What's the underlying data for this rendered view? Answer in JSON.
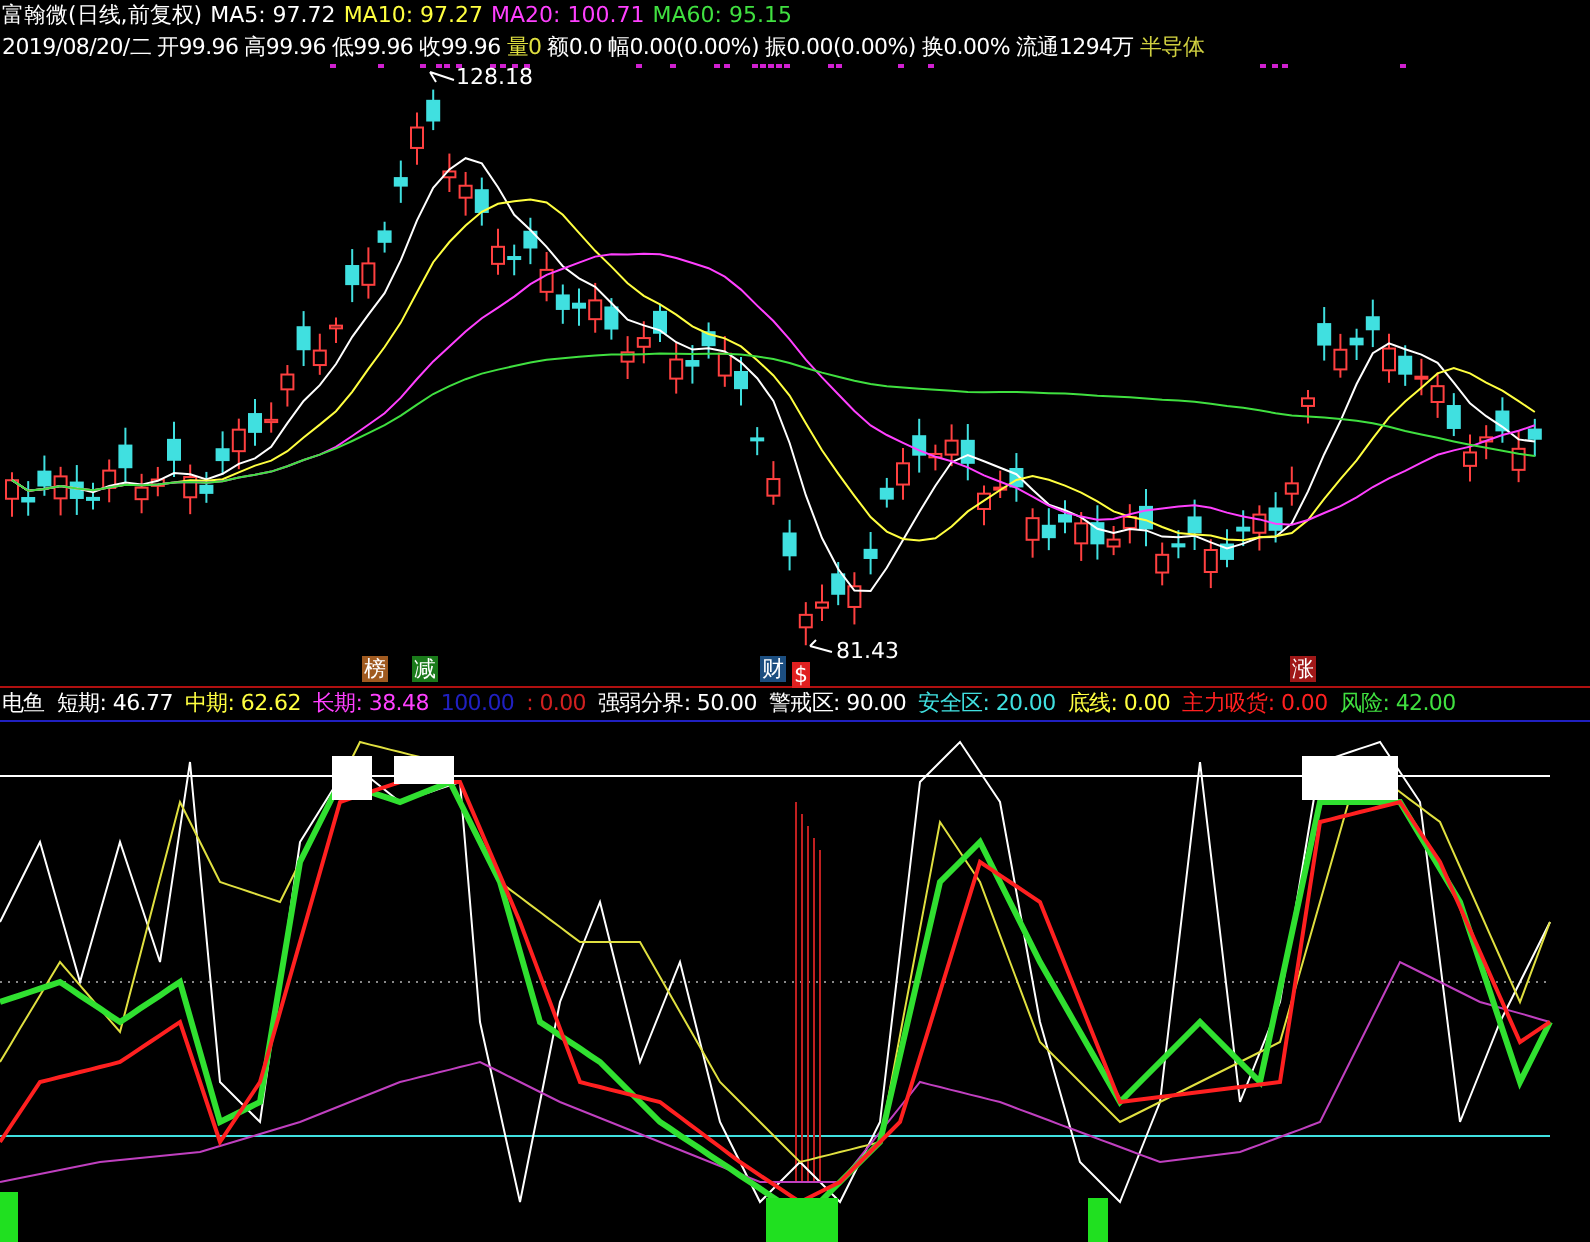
{
  "header": {
    "title": "富翰微(日线,前复权)",
    "ma": [
      "MA5: 97.72",
      "MA10: 97.27",
      "MA20: 100.71",
      "MA60: 95.15"
    ]
  },
  "quote": [
    "2019/08/20/二",
    "开99.96",
    "高99.96",
    "低99.96",
    "收99.96",
    "量0",
    "额0.0",
    "幅0.00(0.00%)",
    "振0.00(0.00%)",
    "换0.00%",
    "流通1294万",
    "半导体"
  ],
  "price_labels": [
    "128.18",
    "81.43"
  ],
  "event_tags": [
    {
      "text": "榜",
      "color": "#a05a20"
    },
    {
      "text": "减",
      "color": "#1a7a1a"
    },
    {
      "text": "财",
      "color": "#1c4e80"
    },
    {
      "text": "$",
      "color": "#e02020"
    },
    {
      "text": "涨",
      "color": "#a01818"
    }
  ],
  "indicator_legend": [
    "电鱼",
    "短期: 46.77",
    "中期: 62.62",
    "长期: 38.48",
    "100.00",
    ": 0.00",
    "强弱分界: 50.00",
    "警戒区: 90.00",
    "安全区: 20.00",
    "底线: 0.00",
    "主力吸货: 0.00",
    "风险: 42.00"
  ]
}
